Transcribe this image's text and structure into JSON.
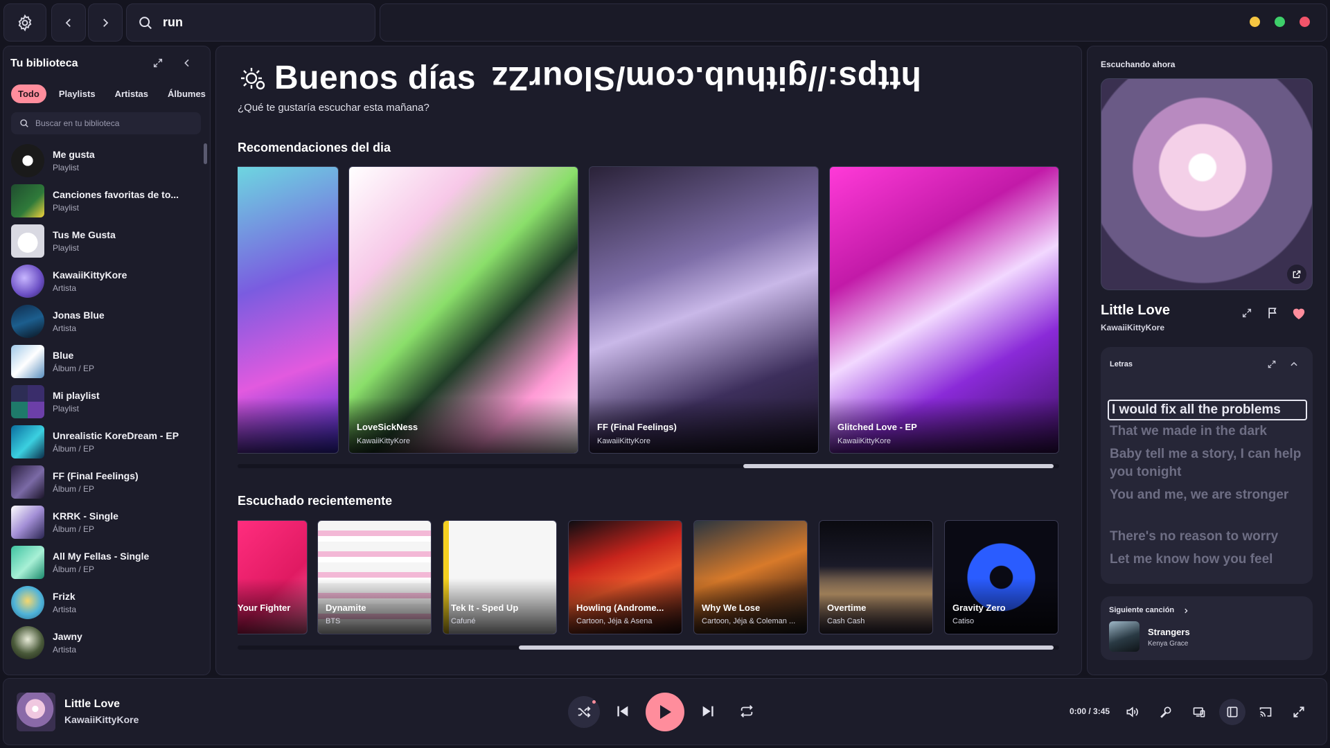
{
  "topbar": {
    "search_value": "run",
    "window_dots": [
      "#f5c542",
      "#3ecf6a",
      "#f2546a"
    ]
  },
  "library": {
    "title": "Tu biblioteca",
    "filters": [
      "Todo",
      "Playlists",
      "Artistas",
      "Álbumes"
    ],
    "search_placeholder": "Buscar en tu biblioteca",
    "items": [
      {
        "name": "Me gusta",
        "type": "Playlist"
      },
      {
        "name": "Canciones favoritas de to...",
        "type": "Playlist"
      },
      {
        "name": "Tus Me Gusta",
        "type": "Playlist"
      },
      {
        "name": "KawaiiKittyKore",
        "type": "Artista"
      },
      {
        "name": "Jonas Blue",
        "type": "Artista"
      },
      {
        "name": "Blue",
        "type": "Álbum / EP"
      },
      {
        "name": "Mi playlist",
        "type": "Playlist"
      },
      {
        "name": "Unrealistic KoreDream - EP",
        "type": "Álbum / EP"
      },
      {
        "name": "FF (Final Feelings)",
        "type": "Álbum / EP"
      },
      {
        "name": "KRRK - Single",
        "type": "Álbum / EP"
      },
      {
        "name": "All My Fellas - Single",
        "type": "Álbum / EP"
      },
      {
        "name": "Frizk",
        "type": "Artista"
      },
      {
        "name": "Jawny",
        "type": "Artista"
      }
    ]
  },
  "main": {
    "greeting": "Buenos días",
    "greeting_flipped": "https://github.com/SlourZz",
    "subtitle": "¿Qué te gustaría escuchar esta mañana?",
    "recommendations_title": "Recomendaciones del dia",
    "recommendations": [
      {
        "title": "",
        "artist": ""
      },
      {
        "title": "LoveSickNess",
        "artist": "KawaiiKittyKore"
      },
      {
        "title": "FF (Final Feelings)",
        "artist": "KawaiiKittyKore"
      },
      {
        "title": "Glitched Love - EP",
        "artist": "KawaiiKittyKore"
      }
    ],
    "recent_title": "Escuchado recientemente",
    "recent": [
      {
        "title": "Your Fighter",
        "artist": ""
      },
      {
        "title": "Dynamite",
        "artist": "BTS"
      },
      {
        "title": "Tek It - Sped Up",
        "artist": "Cafuné"
      },
      {
        "title": "Howling (Androme...",
        "artist": "Cartoon, Jéja & Asena"
      },
      {
        "title": "Why We Lose",
        "artist": "Cartoon, Jéja & Coleman ..."
      },
      {
        "title": "Overtime",
        "artist": "Cash Cash"
      },
      {
        "title": "Gravity Zero",
        "artist": "Catiso"
      }
    ]
  },
  "now_playing": {
    "label": "Escuchando ahora",
    "title": "Little Love",
    "artist": "KawaiiKittyKore",
    "liked": true,
    "lyrics_label": "Letras",
    "lyrics": [
      "I would fix all the problems",
      "That we made in the dark",
      "Baby tell me a story, I can help you tonight",
      "You and me, we are stronger",
      "There's no reason to worry",
      "Let me know how you feel"
    ],
    "next_label": "Siguiente canción",
    "next_title": "Strangers",
    "next_artist": "Kenya Grace"
  },
  "player": {
    "title": "Little Love",
    "artist": "KawaiiKittyKore",
    "time": "0:00 / 3:45",
    "accent": "#ff8d9c"
  }
}
